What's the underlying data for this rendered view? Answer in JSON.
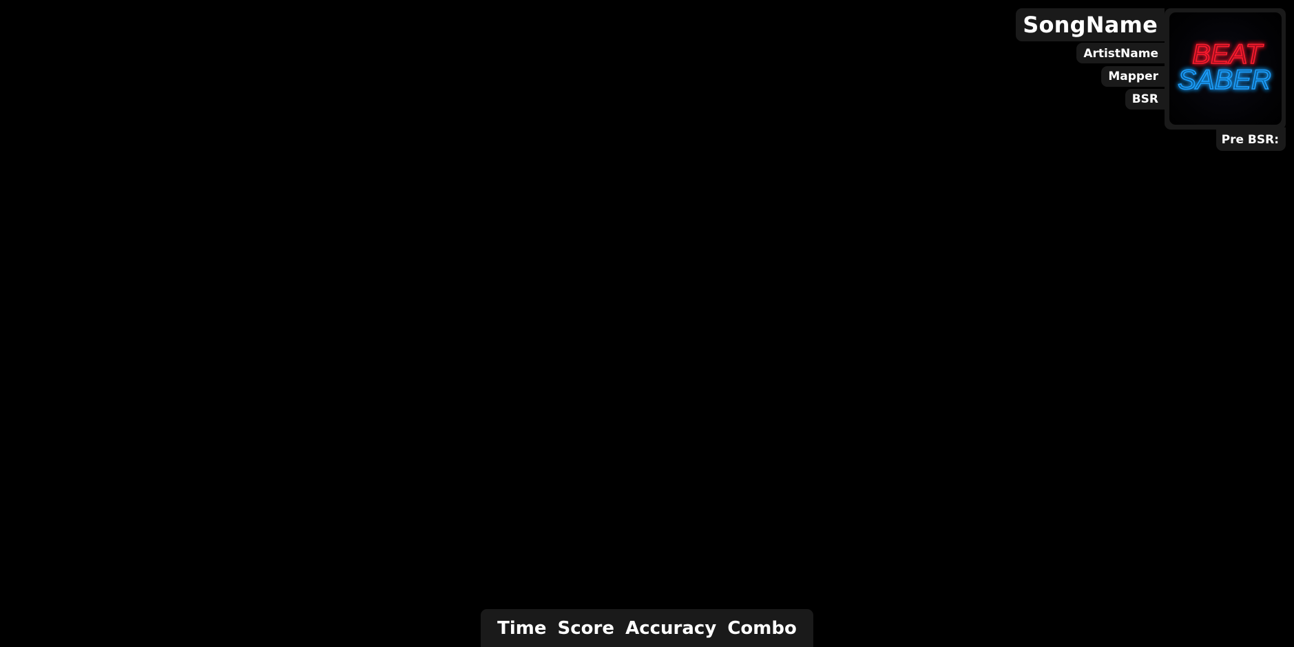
{
  "song_info": {
    "song_name": "SongName",
    "artist_name": "ArtistName",
    "mapper": "Mapper",
    "bsr": "BSR",
    "pre_bsr_label": "Pre BSR:",
    "cover_logo": {
      "line1": "BEAT",
      "line2": "SABER",
      "line1_color": "#ff1a2e",
      "line2_color": "#1ea0ff"
    }
  },
  "stats": {
    "time_label": "Time",
    "score_label": "Score",
    "accuracy_label": "Accuracy",
    "combo_label": "Combo"
  },
  "colors": {
    "background": "#000000",
    "panel": "#1a1a1a",
    "text": "#ffffff"
  }
}
